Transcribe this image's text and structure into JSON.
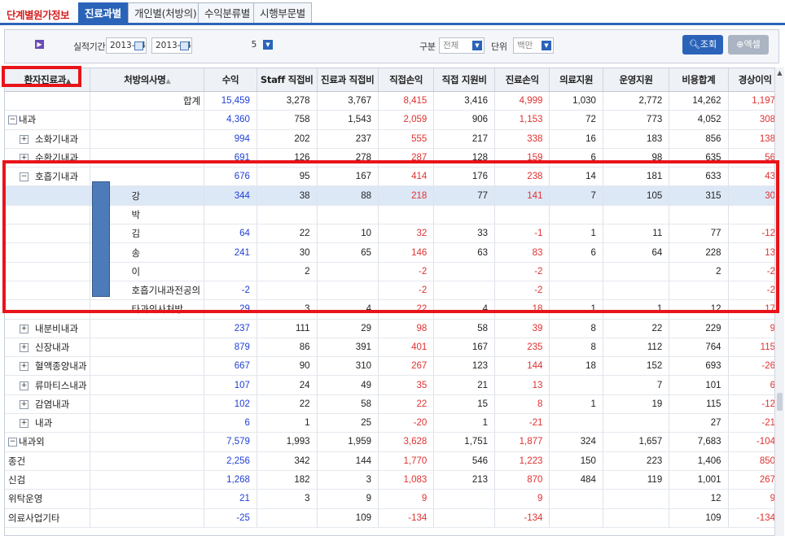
{
  "tabs": {
    "title": "단계별원가정보",
    "items": [
      {
        "label": "진료과별",
        "active": true
      },
      {
        "label": "개인별(처방의)",
        "active": false
      },
      {
        "label": "수익분류별",
        "active": false
      },
      {
        "label": "시행부문별",
        "active": false
      }
    ]
  },
  "filters": {
    "period_label": "실적기간",
    "date_from": "2013-04",
    "date_to": "2013-04",
    "count_value": "5",
    "division_label": "구분",
    "division_value": "전체",
    "unit_label": "단위",
    "unit_value": "백만",
    "search_button": "조회",
    "excel_button": "엑셀"
  },
  "colors": {
    "accent": "#2b63b8",
    "revenue": "#1f3fd6",
    "negative_or_profit": "#e03030",
    "annotation": "#e8141a"
  },
  "columns": [
    "환자진료과",
    "처방의사명",
    "수익",
    "Staff 직접비",
    "진료과 직접비",
    "직접손익",
    "직접 지원비",
    "진료손익",
    "의료지원",
    "운영지원",
    "비용합계",
    "경상이익"
  ],
  "rows": [
    {
      "c1": "",
      "c2": "합계",
      "exp": "",
      "indent": 0,
      "v": [
        "15,459",
        "3,278",
        "3,767",
        "8,415",
        "3,416",
        "4,999",
        "1,030",
        "2,772",
        "14,262",
        "1,197"
      ]
    },
    {
      "c1": "내과",
      "c2": "",
      "exp": "−",
      "indent": 0,
      "v": [
        "4,360",
        "758",
        "1,543",
        "2,059",
        "906",
        "1,153",
        "72",
        "773",
        "4,052",
        "308"
      ]
    },
    {
      "c1": "소화기내과",
      "c2": "",
      "exp": "+",
      "indent": 1,
      "v": [
        "994",
        "202",
        "237",
        "555",
        "217",
        "338",
        "16",
        "183",
        "856",
        "138"
      ]
    },
    {
      "c1": "순환기내과",
      "c2": "",
      "exp": "+",
      "indent": 1,
      "v": [
        "691",
        "126",
        "278",
        "287",
        "128",
        "159",
        "6",
        "98",
        "635",
        "56"
      ]
    },
    {
      "c1": "호흡기내과",
      "c2": "",
      "exp": "−",
      "indent": 1,
      "v": [
        "676",
        "95",
        "167",
        "414",
        "176",
        "238",
        "14",
        "181",
        "633",
        "43"
      ]
    },
    {
      "c1": "",
      "c2": "강",
      "exp": "",
      "indent": 2,
      "selected": true,
      "v": [
        "344",
        "38",
        "88",
        "218",
        "77",
        "141",
        "7",
        "105",
        "315",
        "30"
      ]
    },
    {
      "c1": "",
      "c2": "박",
      "exp": "",
      "indent": 2,
      "v": [
        "",
        "",
        "",
        "",
        "",
        "",
        "",
        "",
        "",
        ""
      ]
    },
    {
      "c1": "",
      "c2": "김",
      "exp": "",
      "indent": 2,
      "v": [
        "64",
        "22",
        "10",
        "32",
        "33",
        "-1",
        "1",
        "11",
        "77",
        "-12"
      ]
    },
    {
      "c1": "",
      "c2": "송",
      "exp": "",
      "indent": 2,
      "v": [
        "241",
        "30",
        "65",
        "146",
        "63",
        "83",
        "6",
        "64",
        "228",
        "13"
      ]
    },
    {
      "c1": "",
      "c2": "이",
      "exp": "",
      "indent": 2,
      "v": [
        "",
        "2",
        "",
        "-2",
        "",
        "-2",
        "",
        "",
        "2",
        "-2"
      ]
    },
    {
      "c1": "",
      "c2": "호흡기내과전공의",
      "exp": "",
      "indent": 2,
      "v": [
        "-2",
        "",
        "",
        "-2",
        "",
        "-2",
        "",
        "",
        "",
        "-2"
      ]
    },
    {
      "c1": "",
      "c2": "타과의사처방",
      "exp": "",
      "indent": 2,
      "v": [
        "29",
        "3",
        "4",
        "22",
        "4",
        "18",
        "1",
        "1",
        "12",
        "17"
      ]
    },
    {
      "c1": "내분비내과",
      "c2": "",
      "exp": "+",
      "indent": 1,
      "v": [
        "237",
        "111",
        "29",
        "98",
        "58",
        "39",
        "8",
        "22",
        "229",
        "9"
      ]
    },
    {
      "c1": "신장내과",
      "c2": "",
      "exp": "+",
      "indent": 1,
      "v": [
        "879",
        "86",
        "391",
        "401",
        "167",
        "235",
        "8",
        "112",
        "764",
        "115"
      ]
    },
    {
      "c1": "혈액종양내과",
      "c2": "",
      "exp": "+",
      "indent": 1,
      "v": [
        "667",
        "90",
        "310",
        "267",
        "123",
        "144",
        "18",
        "152",
        "693",
        "-26"
      ]
    },
    {
      "c1": "류마티스내과",
      "c2": "",
      "exp": "+",
      "indent": 1,
      "v": [
        "107",
        "24",
        "49",
        "35",
        "21",
        "13",
        "",
        "7",
        "101",
        "6"
      ]
    },
    {
      "c1": "감염내과",
      "c2": "",
      "exp": "+",
      "indent": 1,
      "v": [
        "102",
        "22",
        "58",
        "22",
        "15",
        "8",
        "1",
        "19",
        "115",
        "-12"
      ]
    },
    {
      "c1": "내과",
      "c2": "",
      "exp": "+",
      "indent": 1,
      "v": [
        "6",
        "1",
        "25",
        "-20",
        "1",
        "-21",
        "",
        "",
        "27",
        "-21"
      ]
    },
    {
      "c1": "내과외",
      "c2": "",
      "exp": "−",
      "indent": 0,
      "v": [
        "7,579",
        "1,993",
        "1,959",
        "3,628",
        "1,751",
        "1,877",
        "324",
        "1,657",
        "7,683",
        "-104"
      ]
    },
    {
      "c1": "종건",
      "c2": "",
      "exp": "",
      "indent": 0,
      "v": [
        "2,256",
        "342",
        "144",
        "1,770",
        "546",
        "1,223",
        "150",
        "223",
        "1,406",
        "850"
      ]
    },
    {
      "c1": "신검",
      "c2": "",
      "exp": "",
      "indent": 0,
      "v": [
        "1,268",
        "182",
        "3",
        "1,083",
        "213",
        "870",
        "484",
        "119",
        "1,001",
        "267"
      ]
    },
    {
      "c1": "위탁운영",
      "c2": "",
      "exp": "",
      "indent": 0,
      "v": [
        "21",
        "3",
        "9",
        "9",
        "",
        "9",
        "",
        "",
        "12",
        "9"
      ]
    },
    {
      "c1": "의료사업기타",
      "c2": "",
      "exp": "",
      "indent": 0,
      "v": [
        "-25",
        "",
        "109",
        "-134",
        "",
        "-134",
        "",
        "",
        "109",
        "-134"
      ]
    }
  ]
}
